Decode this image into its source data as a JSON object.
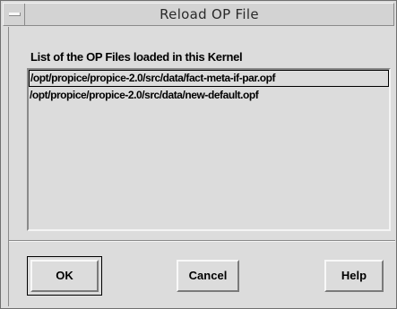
{
  "window": {
    "title": "Reload OP File"
  },
  "main": {
    "list_label": "List of the OP Files loaded in this Kernel",
    "files": [
      "/opt/propice/propice-2.0/src/data/fact-meta-if-par.opf",
      "/opt/propice/propice-2.0/src/data/new-default.opf"
    ],
    "selected_index": 0
  },
  "buttons": {
    "ok_label": "OK",
    "cancel_label": "Cancel",
    "help_label": "Help"
  },
  "colors": {
    "background": "#dcdcdc",
    "shadow": "#8a8a8a",
    "highlight": "#f4f4f4"
  },
  "icons": {
    "window_menu": "window-menu-icon"
  }
}
